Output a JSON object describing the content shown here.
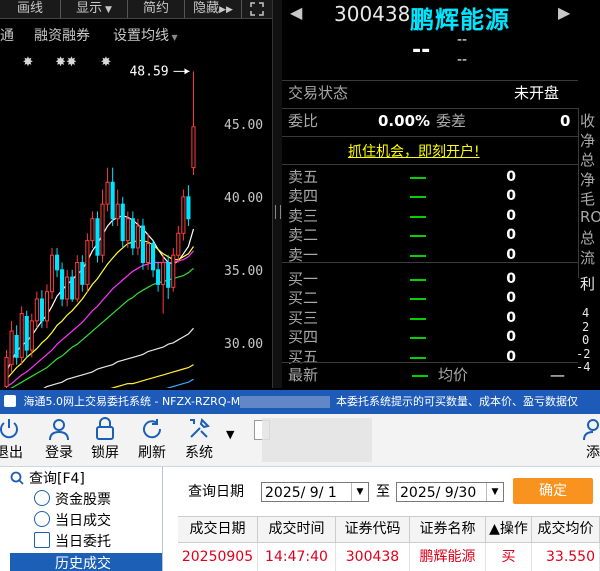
{
  "chart_toolbar": {
    "buttons": [
      "画线",
      "显示",
      "简约",
      "隐藏"
    ],
    "sub_items": [
      "通",
      "融资融券",
      "设置均线"
    ]
  },
  "chart_data": {
    "type": "candlestick",
    "title": "",
    "max_label": "48.59",
    "y_ticks": [
      "45.00",
      "40.00",
      "35.00",
      "30.00"
    ],
    "y_tick_values": [
      45,
      40,
      35,
      30
    ],
    "ylim": [
      26.9,
      50.2
    ],
    "markers": [
      "✸",
      "✸✸",
      "✸"
    ],
    "candles": [
      {
        "o": 27.0,
        "c": 29.0,
        "h": 29.5,
        "l": 26.5,
        "up": true
      },
      {
        "o": 28.5,
        "c": 30.8,
        "h": 31.5,
        "l": 28.0,
        "up": true
      },
      {
        "o": 30.5,
        "c": 29.0,
        "h": 31.2,
        "l": 28.5,
        "up": false
      },
      {
        "o": 29.0,
        "c": 32.0,
        "h": 32.5,
        "l": 28.5,
        "up": true
      },
      {
        "o": 31.8,
        "c": 29.5,
        "h": 32.2,
        "l": 29.0,
        "up": false
      },
      {
        "o": 29.5,
        "c": 31.5,
        "h": 32.0,
        "l": 29.0,
        "up": true
      },
      {
        "o": 31.5,
        "c": 33.0,
        "h": 33.5,
        "l": 31.0,
        "up": true
      },
      {
        "o": 33.0,
        "c": 31.5,
        "h": 33.6,
        "l": 31.0,
        "up": false
      },
      {
        "o": 31.5,
        "c": 33.5,
        "h": 34.0,
        "l": 31.0,
        "up": true
      },
      {
        "o": 33.5,
        "c": 36.0,
        "h": 36.5,
        "l": 33.0,
        "up": true
      },
      {
        "o": 36.0,
        "c": 35.0,
        "h": 36.5,
        "l": 34.5,
        "up": false
      },
      {
        "o": 35.0,
        "c": 33.0,
        "h": 35.5,
        "l": 32.5,
        "up": false
      },
      {
        "o": 33.0,
        "c": 34.5,
        "h": 35.0,
        "l": 32.5,
        "up": true
      },
      {
        "o": 34.5,
        "c": 33.0,
        "h": 35.0,
        "l": 32.8,
        "up": false
      },
      {
        "o": 33.0,
        "c": 35.5,
        "h": 36.0,
        "l": 32.8,
        "up": true
      },
      {
        "o": 35.5,
        "c": 34.0,
        "h": 36.0,
        "l": 33.5,
        "up": false
      },
      {
        "o": 34.0,
        "c": 37.0,
        "h": 37.5,
        "l": 33.5,
        "up": true
      },
      {
        "o": 37.0,
        "c": 38.5,
        "h": 39.0,
        "l": 36.5,
        "up": true
      },
      {
        "o": 38.5,
        "c": 36.0,
        "h": 39.0,
        "l": 35.5,
        "up": false
      },
      {
        "o": 36.0,
        "c": 39.5,
        "h": 40.5,
        "l": 35.5,
        "up": true
      },
      {
        "o": 39.5,
        "c": 41.0,
        "h": 42.0,
        "l": 39.0,
        "up": true
      },
      {
        "o": 41.0,
        "c": 38.5,
        "h": 42.0,
        "l": 38.0,
        "up": false
      },
      {
        "o": 38.5,
        "c": 39.5,
        "h": 40.5,
        "l": 38.0,
        "up": true
      },
      {
        "o": 39.5,
        "c": 37.0,
        "h": 40.0,
        "l": 36.5,
        "up": false
      },
      {
        "o": 37.0,
        "c": 38.5,
        "h": 39.0,
        "l": 36.5,
        "up": true
      },
      {
        "o": 38.5,
        "c": 36.5,
        "h": 39.0,
        "l": 36.0,
        "up": false
      },
      {
        "o": 36.5,
        "c": 38.0,
        "h": 38.5,
        "l": 36.0,
        "up": true
      },
      {
        "o": 38.0,
        "c": 35.5,
        "h": 38.5,
        "l": 35.0,
        "up": false
      },
      {
        "o": 35.5,
        "c": 36.8,
        "h": 37.5,
        "l": 35.0,
        "up": true
      },
      {
        "o": 36.8,
        "c": 35.0,
        "h": 37.0,
        "l": 34.5,
        "up": false
      },
      {
        "o": 35.0,
        "c": 34.0,
        "h": 35.5,
        "l": 33.5,
        "up": false
      },
      {
        "o": 34.0,
        "c": 35.5,
        "h": 36.0,
        "l": 32.0,
        "up": true
      },
      {
        "o": 35.5,
        "c": 33.8,
        "h": 36.0,
        "l": 33.0,
        "up": false
      },
      {
        "o": 33.8,
        "c": 36.0,
        "h": 36.5,
        "l": 33.5,
        "up": true
      },
      {
        "o": 36.0,
        "c": 37.5,
        "h": 38.0,
        "l": 35.5,
        "up": true
      },
      {
        "o": 37.5,
        "c": 40.0,
        "h": 40.5,
        "l": 37.0,
        "up": true
      },
      {
        "o": 40.0,
        "c": 38.5,
        "h": 40.8,
        "l": 38.0,
        "up": false
      },
      {
        "o": 42.0,
        "c": 44.8,
        "h": 48.6,
        "l": 41.5,
        "up": true
      }
    ],
    "ma_lines": [
      {
        "color": "#ffffff",
        "values": [
          28.0,
          28.8,
          29.4,
          29.8,
          30.1,
          30.5,
          31.0,
          31.5,
          31.9,
          32.5,
          33.2,
          33.6,
          34.0,
          34.3,
          34.7,
          35.0,
          35.6,
          36.3,
          36.8,
          37.4,
          38.0,
          38.4,
          38.6,
          38.7,
          38.6,
          38.4,
          38.1,
          37.8,
          37.4,
          37.0,
          36.4,
          35.9,
          35.5,
          35.4,
          35.6,
          36.1,
          36.6,
          37.8
        ]
      },
      {
        "color": "#ffff33",
        "values": [
          27.5,
          27.9,
          28.3,
          28.6,
          29.0,
          29.3,
          29.6,
          30.0,
          30.3,
          30.7,
          31.2,
          31.5,
          31.9,
          32.2,
          32.6,
          33.0,
          33.5,
          34.0,
          34.4,
          34.9,
          35.4,
          35.8,
          36.2,
          36.5,
          36.8,
          36.9,
          37.0,
          37.0,
          36.9,
          36.7,
          36.4,
          36.1,
          35.9,
          35.7,
          35.7,
          35.9,
          36.1,
          36.6
        ]
      },
      {
        "color": "#ff33ff",
        "values": [
          27.0,
          27.2,
          27.5,
          27.8,
          28.0,
          28.3,
          28.6,
          28.9,
          29.2,
          29.5,
          29.9,
          30.2,
          30.5,
          30.8,
          31.1,
          31.4,
          31.8,
          32.2,
          32.5,
          32.9,
          33.3,
          33.7,
          34.0,
          34.3,
          34.6,
          34.9,
          35.1,
          35.3,
          35.4,
          35.5,
          35.5,
          35.5,
          35.5,
          35.5,
          35.6,
          35.7,
          35.9,
          36.3
        ]
      },
      {
        "color": "#33dd33",
        "values": [
          26.8,
          26.9,
          27.1,
          27.3,
          27.5,
          27.7,
          27.9,
          28.1,
          28.3,
          28.6,
          28.9,
          29.1,
          29.4,
          29.7,
          29.9,
          30.2,
          30.5,
          30.8,
          31.1,
          31.4,
          31.7,
          32.0,
          32.3,
          32.6,
          32.9,
          33.1,
          33.4,
          33.6,
          33.8,
          34.0,
          34.1,
          34.2,
          34.3,
          34.4,
          34.5,
          34.6,
          34.8,
          35.1
        ]
      },
      {
        "color": "#e8e8e8",
        "values": [
          26.0,
          26.1,
          26.2,
          26.3,
          26.5,
          26.6,
          26.7,
          26.8,
          27.0,
          27.1,
          27.2,
          27.3,
          27.5,
          27.6,
          27.7,
          27.8,
          27.9,
          28.0,
          28.2,
          28.3,
          28.4,
          28.5,
          28.7,
          28.8,
          28.9,
          29.0,
          29.1,
          29.2,
          29.4,
          29.5,
          29.6,
          29.7,
          29.9,
          30.0,
          30.2,
          30.4,
          30.6,
          31.0
        ]
      },
      {
        "color": "#ffee33",
        "values": [
          25.5,
          25.6,
          25.6,
          25.7,
          25.8,
          25.8,
          25.9,
          25.9,
          26.0,
          26.1,
          26.1,
          26.2,
          26.3,
          26.3,
          26.4,
          26.5,
          26.5,
          26.6,
          26.7,
          26.8,
          26.8,
          26.9,
          27.0,
          27.1,
          27.2,
          27.2,
          27.3,
          27.4,
          27.5,
          27.6,
          27.7,
          27.8,
          27.9,
          28.0,
          28.1,
          28.2,
          28.3,
          28.5
        ]
      },
      {
        "color": "#33aaff",
        "values": [
          25.0,
          25.0,
          25.1,
          25.1,
          25.2,
          25.2,
          25.3,
          25.3,
          25.4,
          25.4,
          25.5,
          25.5,
          25.6,
          25.6,
          25.7,
          25.7,
          25.8,
          25.8,
          25.9,
          26.0,
          26.0,
          26.1,
          26.1,
          26.2,
          26.3,
          26.3,
          26.4,
          26.5,
          26.5,
          26.6,
          26.7,
          26.8,
          26.9,
          27.0,
          27.1,
          27.2,
          27.3,
          27.5
        ]
      }
    ]
  },
  "quote": {
    "code": "300438",
    "name": "鹏辉能源",
    "price": "--",
    "change_top": "--",
    "change_bottom": "--",
    "trade_status_label": "交易状态",
    "trade_status_value": "未开盘",
    "weibi_label": "委比",
    "weibi_value": "0.00%",
    "weicha_label": "委差",
    "weicha_value": "0",
    "promo": "抓住机会，即刻开户!",
    "sell_labels": [
      "卖五",
      "卖四",
      "卖三",
      "卖二",
      "卖一"
    ],
    "buy_labels": [
      "买一",
      "买二",
      "买三",
      "买四",
      "买五"
    ],
    "vol_zero": "0",
    "latest_label": "最新",
    "avg_label": "均价",
    "avg_value": "—",
    "right_labels": [
      "收",
      "净",
      "总",
      "净",
      "毛",
      "RO",
      "总",
      "流",
      "利"
    ],
    "right_numbers": [
      "4",
      "2",
      "0",
      "-2",
      "-4"
    ]
  },
  "trade": {
    "title": "海通5.0网上交易委托系统 - NFZX-RZRQ-M",
    "title_tail": "本委托系统提示的可买数量、成本价、盈亏数据仅",
    "toolbar": [
      "退出",
      "登录",
      "锁屏",
      "刷新",
      "系统"
    ],
    "toolbar_last": "添",
    "tree": {
      "query": "查询[F4]",
      "items": [
        "资金股票",
        "当日成交",
        "当日委托",
        "历史成交"
      ]
    },
    "query_date_label": "查询日期",
    "date_from": "2025/ 9/ 1",
    "to_label": "至",
    "date_to": "2025/ 9/30",
    "confirm": "确定",
    "columns": [
      "成交日期",
      "成交时间",
      "证券代码",
      "证券名称",
      "▲操作",
      "成交均价"
    ],
    "row": [
      "20250905",
      "14:47:40",
      "300438",
      "鹏辉能源",
      "买",
      "33.550"
    ]
  }
}
